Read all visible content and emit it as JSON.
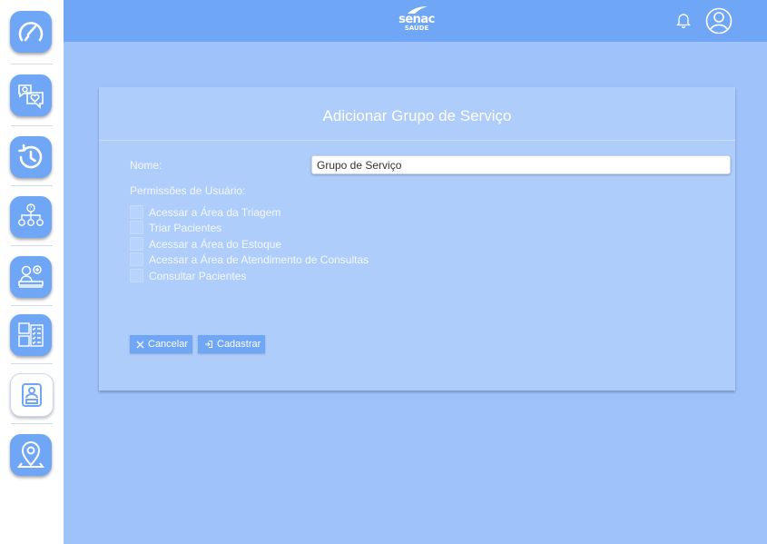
{
  "header": {
    "logo_text": "senac",
    "logo_subtext": "SAÚDE",
    "icons": [
      "bell-icon",
      "user-icon"
    ]
  },
  "sidebar": {
    "items": [
      {
        "name": "dashboard",
        "icon": "speedometer-icon"
      },
      {
        "name": "care",
        "icon": "heart-chat-icon"
      },
      {
        "name": "history",
        "icon": "history-icon"
      },
      {
        "name": "hierarchy",
        "icon": "org-chart-icon"
      },
      {
        "name": "attendance",
        "icon": "doctor-desk-icon"
      },
      {
        "name": "inventory",
        "icon": "boxes-checklist-icon"
      },
      {
        "name": "user-groups",
        "icon": "id-badge-icon",
        "active": true
      },
      {
        "name": "locations",
        "icon": "map-pin-icon"
      }
    ]
  },
  "form": {
    "title": "Adicionar Grupo de Serviço",
    "name_label": "Nome:",
    "name_value": "Grupo de Serviço",
    "permissions_label": "Permissões de Usuário:",
    "permissions": [
      {
        "label": "Acessar a Área da Triagem",
        "checked": false
      },
      {
        "label": "Triar Pacientes",
        "checked": false
      },
      {
        "label": "Acessar a Área do Estoque",
        "checked": false
      },
      {
        "label": "Acessar a Área de Atendimento de Consultas",
        "checked": false
      },
      {
        "label": "Consultar Pacientes",
        "checked": false
      }
    ],
    "cancel_label": "Cancelar",
    "submit_label": "Cadastrar"
  },
  "colors": {
    "primary": "#6fa6f5",
    "background": "#a0c2fa",
    "card": "#aecdfb"
  }
}
